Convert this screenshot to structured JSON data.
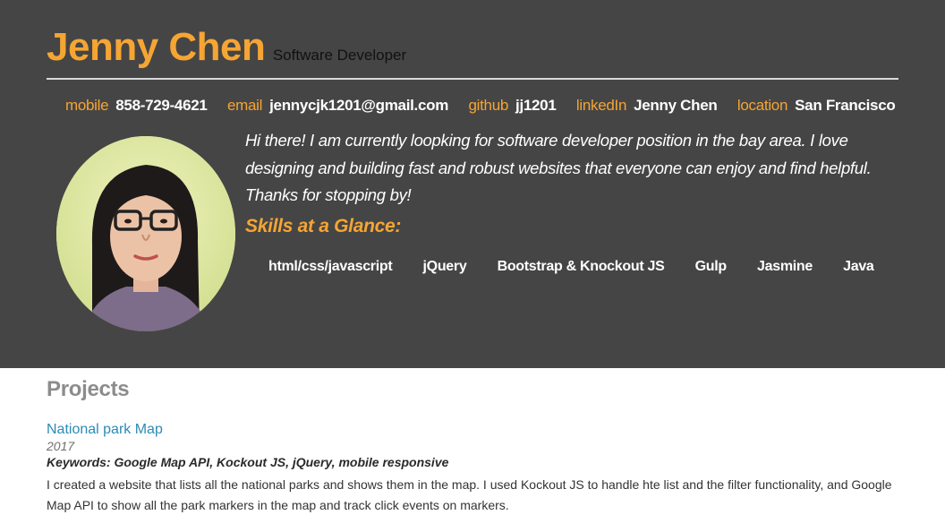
{
  "header": {
    "name": "Jenny Chen",
    "role": "Software Developer",
    "contacts": [
      {
        "label": "mobile",
        "value": "858-729-4621"
      },
      {
        "label": "email",
        "value": "jennycjk1201@gmail.com"
      },
      {
        "label": "github",
        "value": "jj1201"
      },
      {
        "label": "linkedIn",
        "value": "Jenny Chen"
      },
      {
        "label": "location",
        "value": "San Francisco"
      }
    ],
    "intro": "Hi there! I am currently loopking for software developer position in the bay area. I love designing and building fast and robust websites that everyone can enjoy and find helpful. Thanks for stopping by!",
    "skills_title": "Skills at a Glance:",
    "skills": [
      "html/css/javascript",
      "jQuery",
      "Bootstrap & Knockout JS",
      "Gulp",
      "Jasmine",
      "Java"
    ]
  },
  "projects": {
    "title": "Projects",
    "items": [
      {
        "name": "National park Map",
        "year": "2017",
        "keywords": "Keywords: Google Map API, Kockout JS, jQuery, mobile responsive",
        "description": "I created a website that lists all the national parks and shows them in the map. I used Kockout JS to handle hte list and the filter functionality, and Google Map API to show all the park markers in the map and track click events on markers."
      }
    ]
  },
  "colors": {
    "header_bg": "#454545",
    "accent": "#f5a534",
    "link": "#2b8bb6",
    "section_title": "#8c8c8c"
  },
  "icons": {
    "avatar": "profile-photo"
  }
}
